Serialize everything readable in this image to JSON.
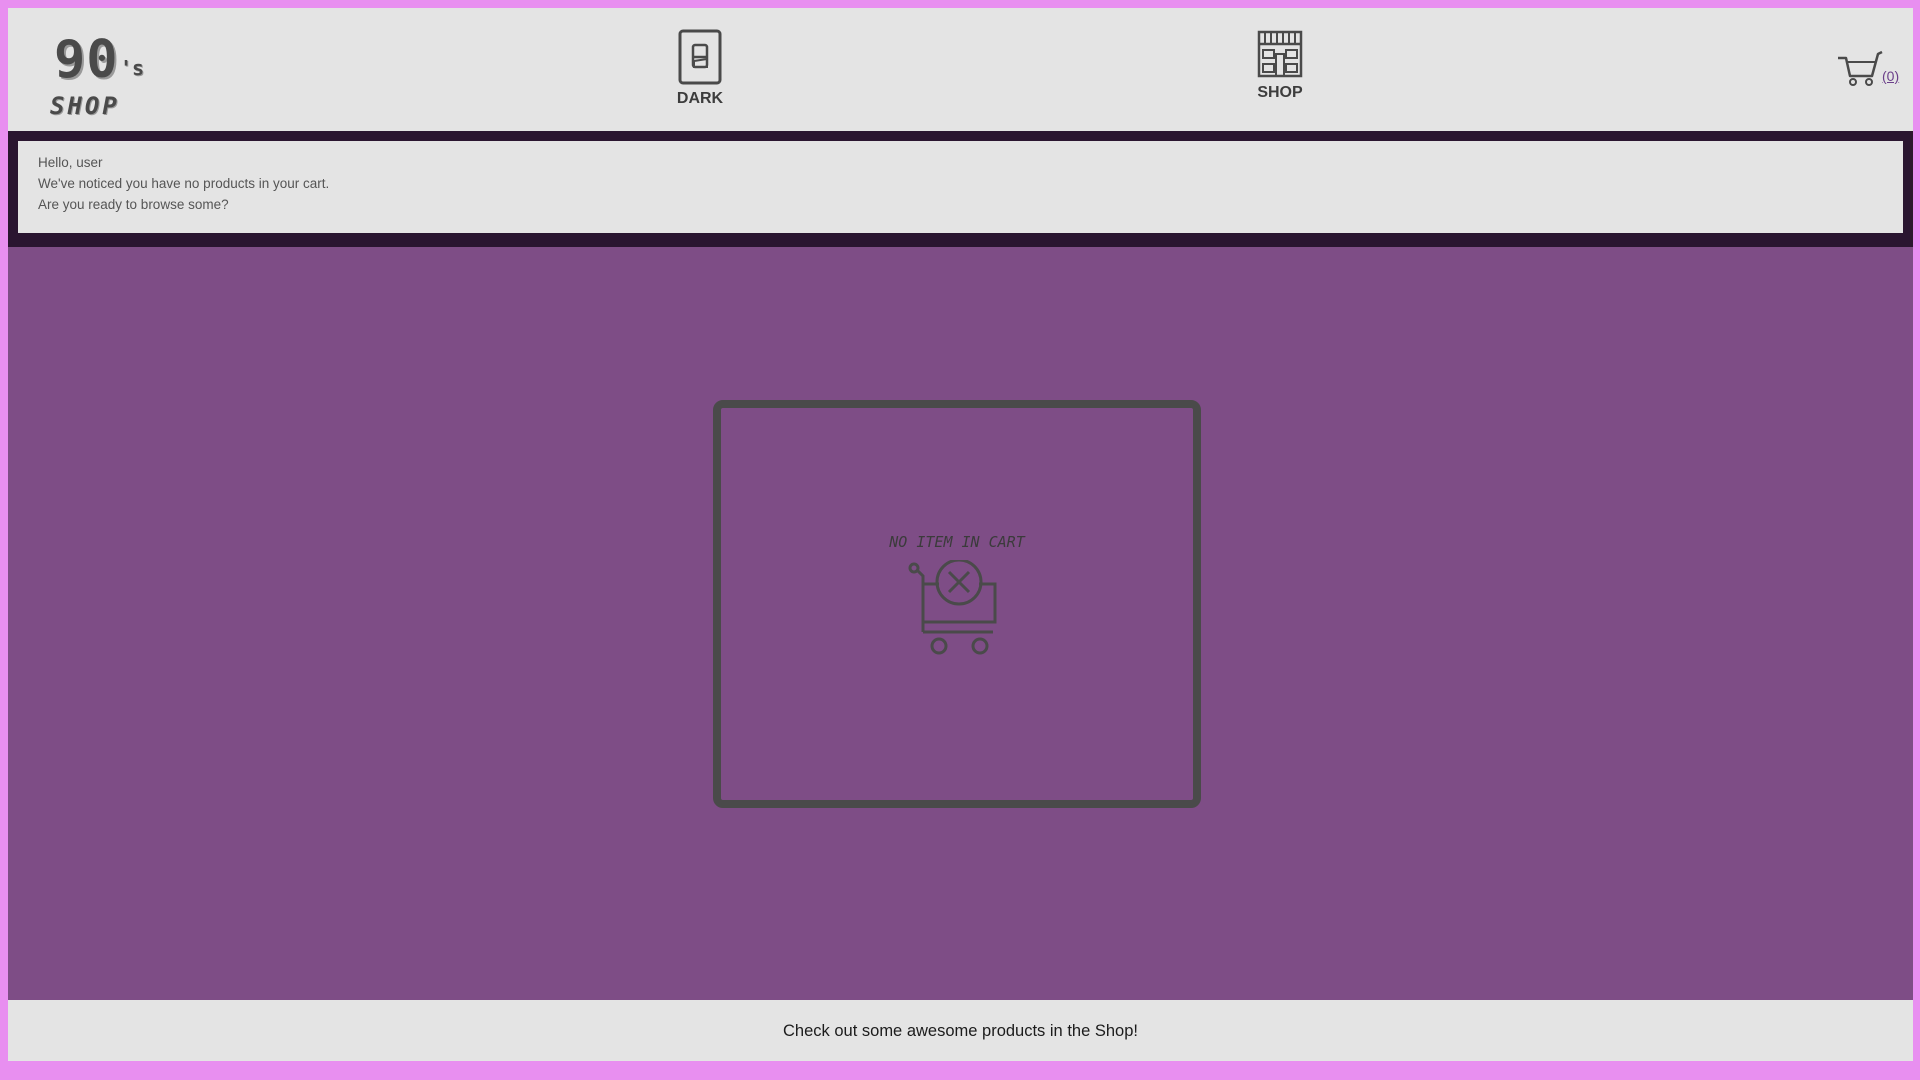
{
  "header": {
    "logo": {
      "main": "90",
      "suffix": "'s",
      "sub": "SHOP"
    },
    "nav": {
      "theme_toggle": {
        "label": "DARK",
        "icon": "light-switch-icon"
      },
      "shop": {
        "label": "SHOP",
        "icon": "storefront-icon"
      }
    },
    "cart": {
      "count": "(0)",
      "icon": "shopping-cart-icon"
    }
  },
  "notice": {
    "greeting": "Hello, user",
    "line1": "We've noticed you have no products in your cart.",
    "line2": "Are you ready to browse some?"
  },
  "empty_cart": {
    "title": "NO ITEM IN CART",
    "icon": "cart-remove-icon"
  },
  "footer": {
    "text": "Check out some awesome products in the Shop!"
  },
  "colors": {
    "page_border": "#e88ff0",
    "header_bg": "#e4e4e4",
    "notice_band": "#2a1530",
    "main_bg": "#7e4d86",
    "outline": "#4a4a4a",
    "link": "#6b3f8a"
  }
}
